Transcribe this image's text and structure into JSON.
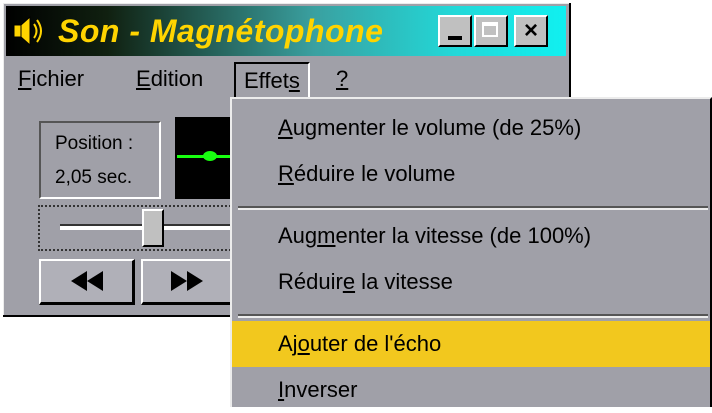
{
  "window": {
    "title": "Son - Magnétophone",
    "app_icon": "speaker-icon",
    "title_color": "#ffd400",
    "controls": {
      "minimize": "minimize-icon",
      "maximize": "maximize-icon",
      "close": "×"
    }
  },
  "menubar": {
    "items": [
      {
        "label": "Fichier",
        "accel": "F"
      },
      {
        "label": "Edition",
        "accel": "E"
      },
      {
        "label": "Effets",
        "accel": "s",
        "open": true
      },
      {
        "label": "?",
        "accel": "?"
      }
    ]
  },
  "position": {
    "label": "Position :",
    "value": "2,05 sec."
  },
  "waveform": {
    "color": "#18ff10"
  },
  "slider": {
    "value_fraction": 0.45
  },
  "transport": {
    "rewind_icon": "rewind-icon",
    "fast_forward_icon": "fast-forward-icon"
  },
  "dropdown": {
    "highlight_color": "#f2c81e",
    "items": [
      {
        "pre": "",
        "accel": "A",
        "post": "ugmenter le volume (de 25%)"
      },
      {
        "pre": "",
        "accel": "R",
        "post": "éduire le volume"
      },
      {
        "pre": "Aug",
        "accel": "m",
        "post": "enter la vitesse (de 100%)"
      },
      {
        "pre": "Réduir",
        "accel": "e",
        "post": " la vitesse"
      },
      {
        "pre": "Aj",
        "accel": "o",
        "post": "uter de l'écho",
        "highlighted": true
      },
      {
        "pre": "",
        "accel": "I",
        "post": "nverser"
      }
    ]
  }
}
